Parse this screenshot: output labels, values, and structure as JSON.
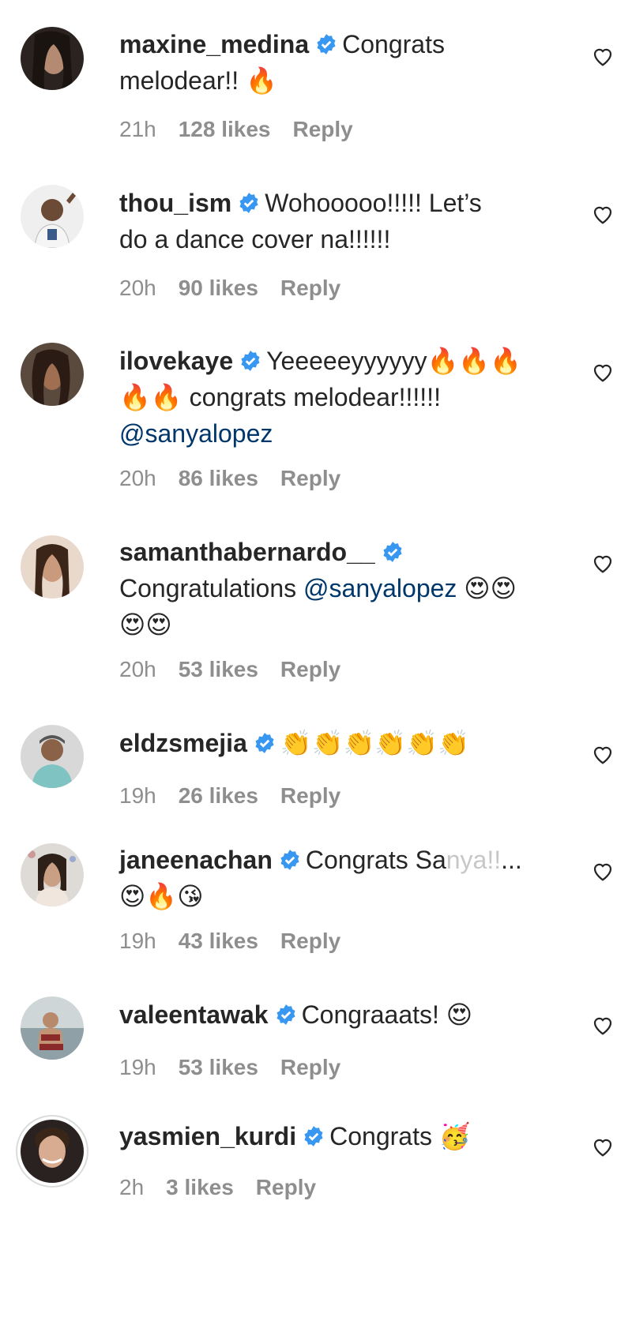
{
  "comments": [
    {
      "username": "maxine_medina",
      "text": "Congrats",
      "text2": "melodear!! 🔥",
      "time": "21h",
      "likes": "128 likes",
      "reply": "Reply"
    },
    {
      "username": "thou_ism",
      "text": "Wohooooo!!!!! Let’s",
      "text2": "do a dance cover na!!!!!!",
      "time": "20h",
      "likes": "90 likes",
      "reply": "Reply"
    },
    {
      "username": "ilovekaye",
      "text": "Yeeeeeyyyyyy🔥🔥🔥",
      "text2": "🔥🔥 congrats melodear!!!!!!",
      "text3": "@sanyalopez",
      "time": "20h",
      "likes": "86 likes",
      "reply": "Reply"
    },
    {
      "username": "samanthabernardo__",
      "text": "",
      "text2": "Congratulations",
      "mention": "@sanyalopez",
      "emoji": "😍😍",
      "text3": "😍😍",
      "time": "20h",
      "likes": "53 likes",
      "reply": "Reply"
    },
    {
      "username": "eldzsmejia",
      "text": "👏👏👏👏👏👏",
      "time": "19h",
      "likes": "26 likes",
      "reply": "Reply"
    },
    {
      "username": "janeenachan",
      "text": "Congrats Sa",
      "more": "nya!!",
      "ellipsis": "...",
      "text2": "😍🔥😘",
      "time": "19h",
      "likes": "43 likes",
      "reply": "Reply"
    },
    {
      "username": "valeentawak",
      "text": "Congraaats! 😍",
      "time": "19h",
      "likes": "53 likes",
      "reply": "Reply"
    },
    {
      "username": "yasmien_kurdi",
      "text": "Congrats 🥳",
      "time": "2h",
      "likes": "3 likes",
      "reply": "Reply"
    }
  ],
  "colors": {
    "text": "#262626",
    "meta": "#8e8e8e",
    "mention": "#00376b",
    "verified": "#3897f0"
  }
}
